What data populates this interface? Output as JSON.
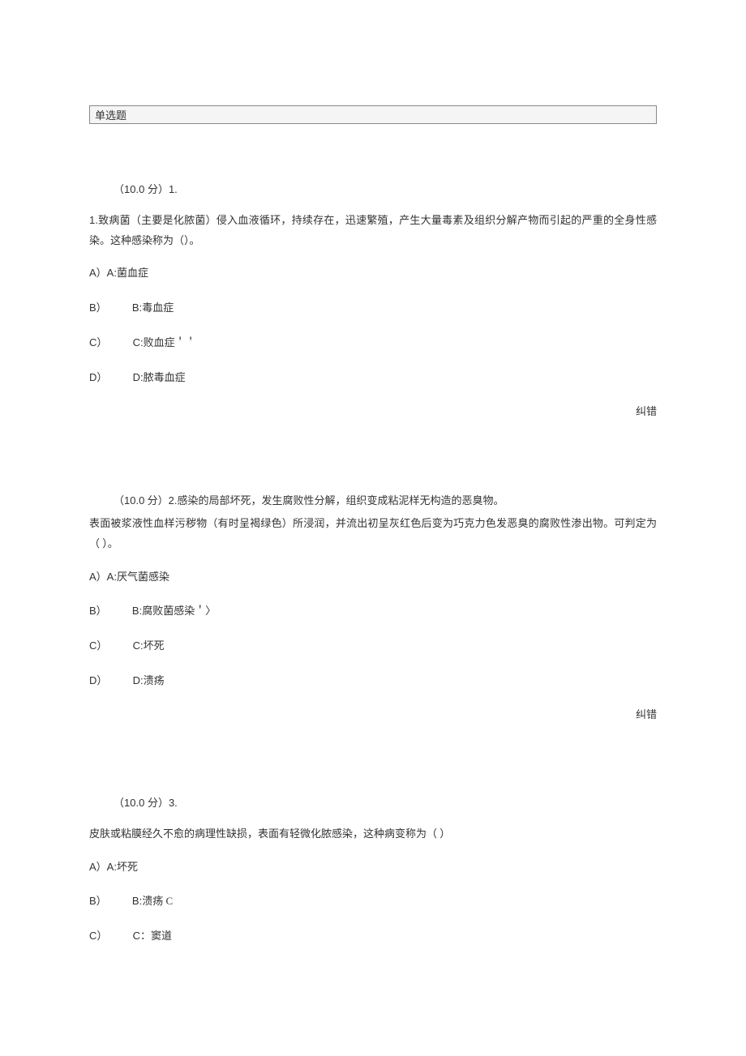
{
  "section_title": "单选题",
  "q1": {
    "points_prefix": "（",
    "points": "10.0",
    "points_unit": " 分）",
    "number": "1.",
    "stem_prefix": "1.",
    "stem": "致病菌（主要是化脓菌）侵入血液循环，持续存在，迅速繁殖，产生大量毒素及组织分解产物而引起的严重的全身性感染。这种感染称为（）。",
    "optA_key": "A）A:",
    "optA_text": "菌血症",
    "optB_key1": "B）",
    "optB_key2": "B:",
    "optB_text": "毒血症",
    "optC_key1": "C）",
    "optC_key2": "C:",
    "optC_text": "败血症＇＇",
    "optD_key1": "D）",
    "optD_key2": "D:",
    "optD_text": "脓毒血症",
    "correction": "纠错"
  },
  "q2": {
    "points_prefix": "（",
    "points": "10.0",
    "points_unit": " 分）",
    "number": "2.",
    "stem_line1": "感染的局部坏死，发生腐败性分解，组织变成粘泥样无构造的恶臭物。",
    "stem_line2": "表面被浆液性血样污秽物（有时呈褐绿色）所浸润，并流出初呈灰红色后变为巧克力色发恶臭的腐败性渗出物。可判定为（  ）。",
    "optA_key": "A）A:",
    "optA_text": "厌气菌感染",
    "optB_key1": "B）",
    "optB_key2": "B:",
    "optB_text": "腐败菌感染＇〉",
    "optC_key1": "C）",
    "optC_key2": "C:",
    "optC_text": "坏死",
    "optD_key1": "D）",
    "optD_key2": "D:",
    "optD_text": "溃疡",
    "correction": "纠错"
  },
  "q3": {
    "points_prefix": "（",
    "points": "10.0",
    "points_unit": " 分）",
    "number": "3.",
    "stem": "皮肤或粘膜经久不愈的病理性缺损，表面有轻微化脓感染，这种病变称为（  ）",
    "optA_key": "A）A:",
    "optA_text": "坏死",
    "optB_key1": "B）",
    "optB_key2": "B:",
    "optB_text": "溃疡 C",
    "optC_key1": "C）",
    "optC_key2": "C：",
    "optC_text": "窦道"
  }
}
